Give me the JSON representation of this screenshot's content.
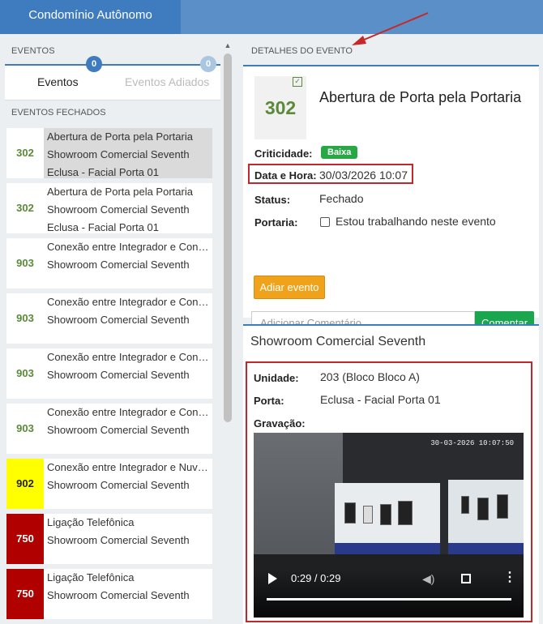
{
  "app": {
    "title": "Condomínio Autônomo"
  },
  "left": {
    "header": "EVENTOS",
    "tabs": [
      {
        "label": "Eventos",
        "count": "0"
      },
      {
        "label": "Eventos Adiados",
        "count": "0"
      }
    ],
    "closed_header": "EVENTOS FECHADOS",
    "events": [
      {
        "code": "302",
        "lines": [
          "Abertura de Porta pela Portaria",
          "Showroom Comercial Seventh",
          "Eclusa - Facial Porta 01"
        ],
        "color": "#5a8a3a"
      },
      {
        "code": "302",
        "lines": [
          "Abertura de Porta pela Portaria",
          "Showroom Comercial Seventh",
          "Eclusa - Facial Porta 01"
        ],
        "color": "#5a8a3a"
      },
      {
        "code": "903",
        "lines": [
          "Conexão entre Integrador e Cont...",
          "Showroom Comercial Seventh",
          ""
        ],
        "color": "#5a8a3a"
      },
      {
        "code": "903",
        "lines": [
          "Conexão entre Integrador e Cont...",
          "Showroom Comercial Seventh",
          ""
        ],
        "color": "#5a8a3a"
      },
      {
        "code": "903",
        "lines": [
          "Conexão entre Integrador e Cont...",
          "Showroom Comercial Seventh",
          ""
        ],
        "color": "#5a8a3a"
      },
      {
        "code": "903",
        "lines": [
          "Conexão entre Integrador e Cont...",
          "Showroom Comercial Seventh",
          ""
        ],
        "color": "#5a8a3a"
      },
      {
        "code": "902",
        "lines": [
          "Conexão entre Integrador e Nuve...",
          "Showroom Comercial Seventh",
          ""
        ],
        "color": "#ffff00"
      },
      {
        "code": "750",
        "lines": [
          "Ligação Telefônica",
          "Showroom Comercial Seventh",
          ""
        ],
        "color": "#b00000"
      },
      {
        "code": "750",
        "lines": [
          "Ligação Telefônica",
          "Showroom Comercial Seventh",
          ""
        ],
        "color": "#b00000"
      }
    ]
  },
  "details": {
    "header": "DETALHES DO EVENTO",
    "code": "302",
    "title": "Abertura de Porta pela Portaria",
    "criticidade_label": "Criticidade:",
    "criticidade_value": "Baixa",
    "datahora_label": "Data e Hora:",
    "datahora_value": "30/03/2026 10:07",
    "status_label": "Status:",
    "status_value": "Fechado",
    "portaria_label": "Portaria:",
    "portaria_checkbox_label": "Estou trabalhando neste evento",
    "adiar_label": "Adiar evento",
    "comment_placeholder": "Adicionar Comentário...",
    "comentar_label": "Comentar"
  },
  "location": {
    "title": "Showroom Comercial Seventh",
    "unidade_label": "Unidade:",
    "unidade_value": "203 (Bloco Bloco A)",
    "porta_label": "Porta:",
    "porta_value": "Eclusa - Facial Porta 01",
    "gravacao_label": "Gravação:",
    "video": {
      "timestamp": "30-03-2026 10:07:50",
      "time": "0:29 / 0:29"
    }
  },
  "colors": {
    "accent": "#3f7bbf",
    "success": "#28a745",
    "warning": "#f0a31a",
    "highlight": "#c0282c"
  }
}
